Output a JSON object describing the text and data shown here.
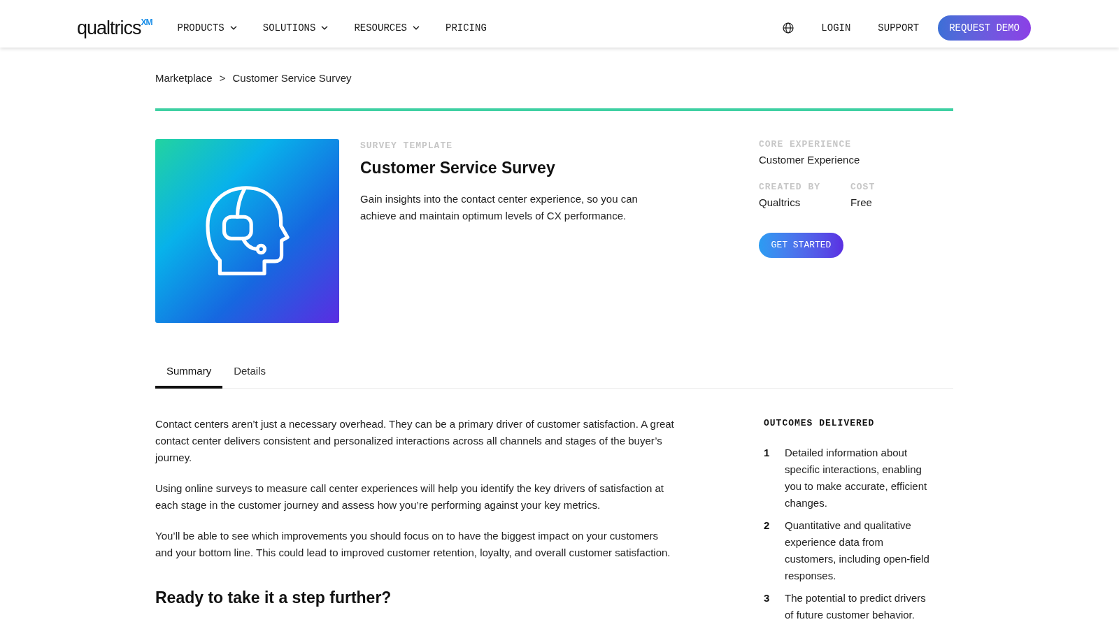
{
  "header": {
    "logo": {
      "wordmark": "qualtrics",
      "superscript": "XM"
    },
    "nav": [
      {
        "label": "PRODUCTS",
        "dropdown": true
      },
      {
        "label": "SOLUTIONS",
        "dropdown": true
      },
      {
        "label": "RESOURCES",
        "dropdown": true
      },
      {
        "label": "PRICING",
        "dropdown": false
      }
    ],
    "links": [
      {
        "label": "LOGIN"
      },
      {
        "label": "SUPPORT"
      }
    ],
    "cta": "REQUEST DEMO"
  },
  "breadcrumb": {
    "items": [
      {
        "label": "Marketplace"
      },
      {
        "label": "Customer Service Survey"
      }
    ],
    "separator": ">"
  },
  "product": {
    "eyebrow": "SURVEY TEMPLATE",
    "title": "Customer Service Survey",
    "description": "Gain insights into the contact center experience, so you can achieve and maintain optimum levels of CX performance.",
    "meta": [
      {
        "label": "CORE EXPERIENCE",
        "value": "Customer Experience"
      },
      {
        "label": "CREATED BY",
        "value": "Qualtrics"
      },
      {
        "label": "COST",
        "value": "Free"
      }
    ],
    "button": "GET STARTED"
  },
  "tabs": [
    {
      "label": "Summary",
      "selected": true
    },
    {
      "label": "Details",
      "selected": false
    }
  ],
  "summary": {
    "paragraphs": [
      "Contact centers aren’t just a necessary overhead. They can be a primary driver of customer satisfaction. A great contact center delivers consistent and personalized interactions across all channels and stages of the buyer’s journey.",
      "Using online surveys to measure call center experiences will help you identify the key drivers of satisfaction at each stage in the customer journey and assess how you’re performing against your key metrics.",
      "You’ll be able to see which improvements you should focus on to have the biggest impact on your customers and your bottom line. This could lead to improved customer retention, loyalty, and overall customer satisfaction."
    ],
    "heading": "Ready to take it a step further?"
  },
  "outcomes": {
    "title": "OUTCOMES DELIVERED",
    "items": [
      {
        "number": "1",
        "text": "Detailed information about specific interactions, enabling you to make accurate, efficient changes."
      },
      {
        "number": "2",
        "text": "Quantitative and qualitative experience data from customers, including open-field responses."
      },
      {
        "number": "3",
        "text": "The potential to predict drivers of future customer behavior."
      }
    ]
  }
}
